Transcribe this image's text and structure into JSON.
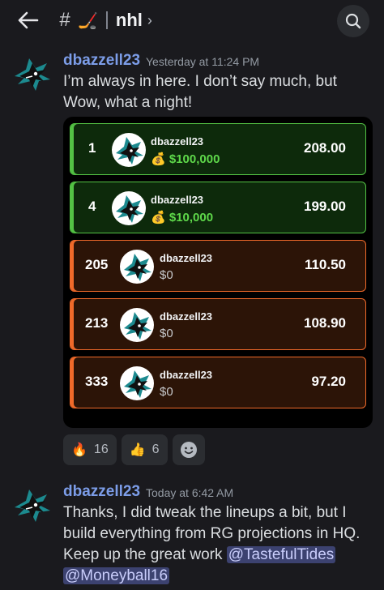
{
  "header": {
    "channel_name": "nhl",
    "hash": "#",
    "channel_emoji": "🏒"
  },
  "messages": [
    {
      "author": "dbazzell23",
      "time": "Yesterday at 11:24 PM",
      "text": "I’m always in here. I don’t say much, but Wow, what a night!"
    },
    {
      "author": "dbazzell23",
      "time": "Today at 6:42 AM",
      "text": "Thanks, I did tweak the lineups a bit, but I build everything from RG projections in HQ. Keep up the great work",
      "mentions": [
        "@TastefulTides",
        "@Moneyball16"
      ]
    }
  ],
  "leaderboard": [
    {
      "rank": "1",
      "user": "dbazzell23",
      "prize": "$100,000",
      "score": "208.00",
      "status": "win"
    },
    {
      "rank": "4",
      "user": "dbazzell23",
      "prize": "$10,000",
      "score": "199.00",
      "status": "win"
    },
    {
      "rank": "205",
      "user": "dbazzell23",
      "prize": "$0",
      "score": "110.50",
      "status": "lose"
    },
    {
      "rank": "213",
      "user": "dbazzell23",
      "prize": "$0",
      "score": "108.90",
      "status": "lose"
    },
    {
      "rank": "333",
      "user": "dbazzell23",
      "prize": "$0",
      "score": "97.20",
      "status": "lose"
    }
  ],
  "prize_icon": "💰",
  "reactions": [
    {
      "emoji": "🔥",
      "count": "16"
    },
    {
      "emoji": "👍",
      "count": "6"
    }
  ],
  "colors": {
    "win": "#53c244",
    "lose": "#f06a2a",
    "author": "#7c9de8"
  }
}
